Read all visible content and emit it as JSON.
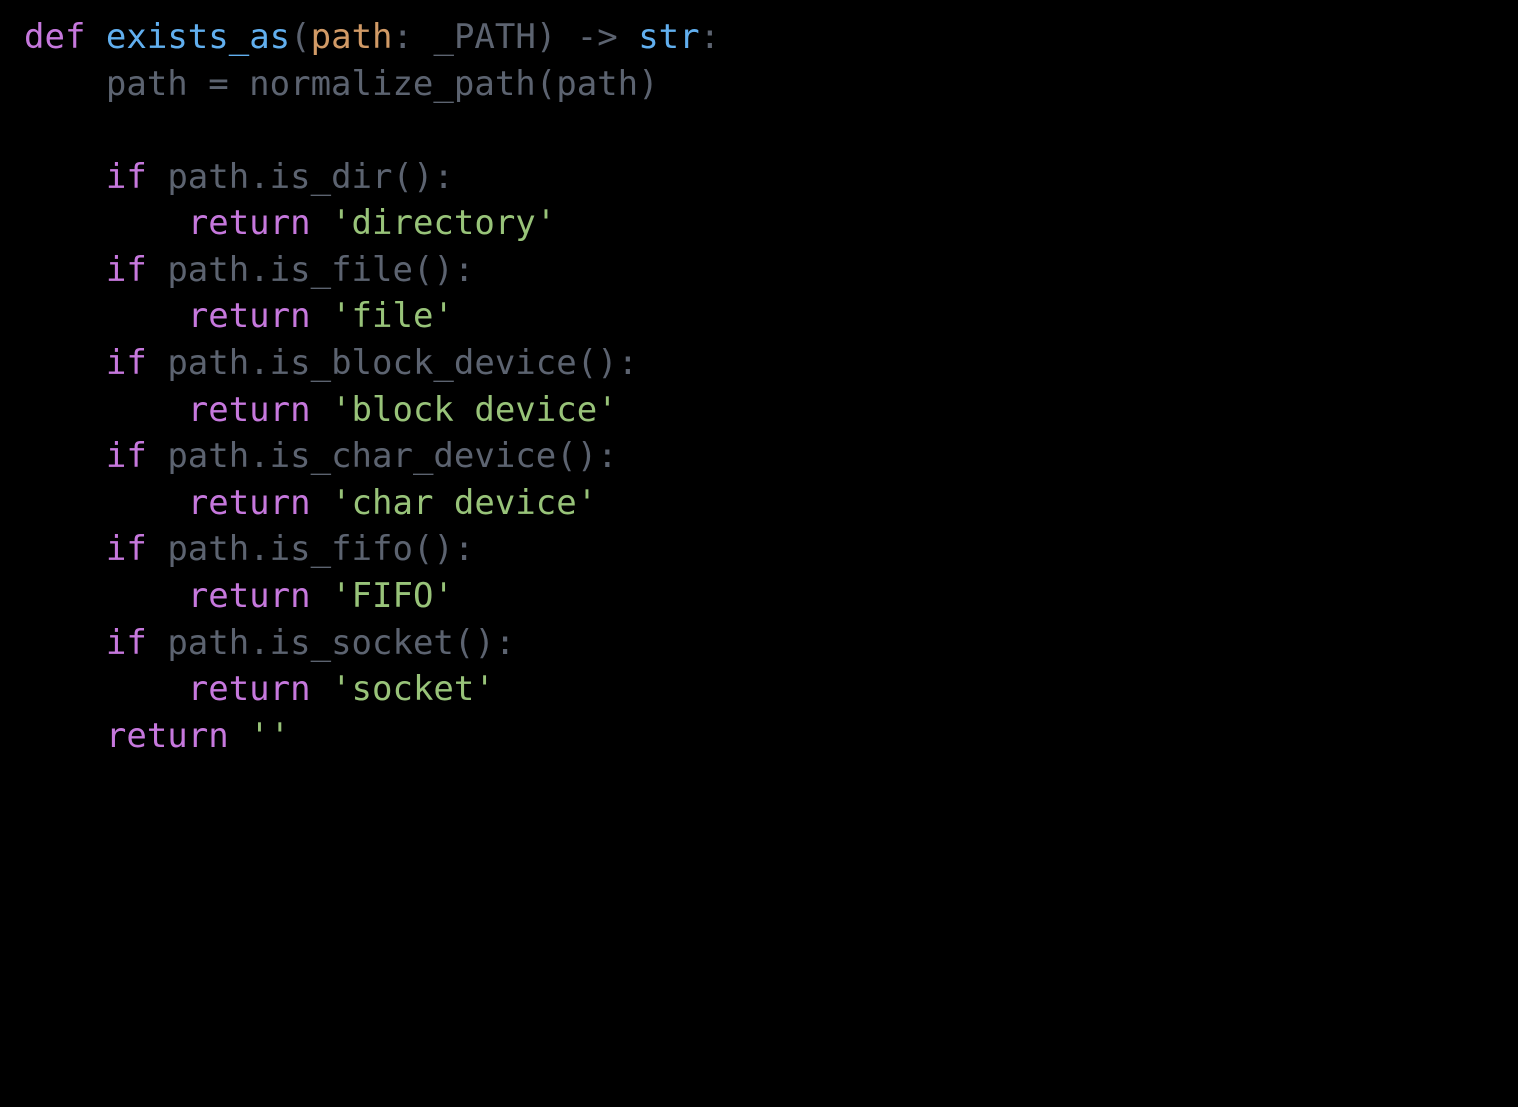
{
  "code": {
    "def": "def",
    "fn": "exists_as",
    "lp": "(",
    "param": "path",
    "colon1": ": ",
    "type": "_PATH",
    "rp": ")",
    "arrow": " -> ",
    "ret_type": "str",
    "colon_end": ":",
    "line2": "path = normalize_path(path)",
    "if_kw": "if",
    "return_kw": "return",
    "branches": [
      {
        "cond": " path.is_dir():",
        "value": "'directory'"
      },
      {
        "cond": " path.is_file():",
        "value": "'file'"
      },
      {
        "cond": " path.is_block_device():",
        "value": "'block device'"
      },
      {
        "cond": " path.is_char_device():",
        "value": "'char device'"
      },
      {
        "cond": " path.is_fifo():",
        "value": "'FIFO'"
      },
      {
        "cond": " path.is_socket():",
        "value": "'socket'"
      }
    ],
    "final_return_value": "''"
  }
}
